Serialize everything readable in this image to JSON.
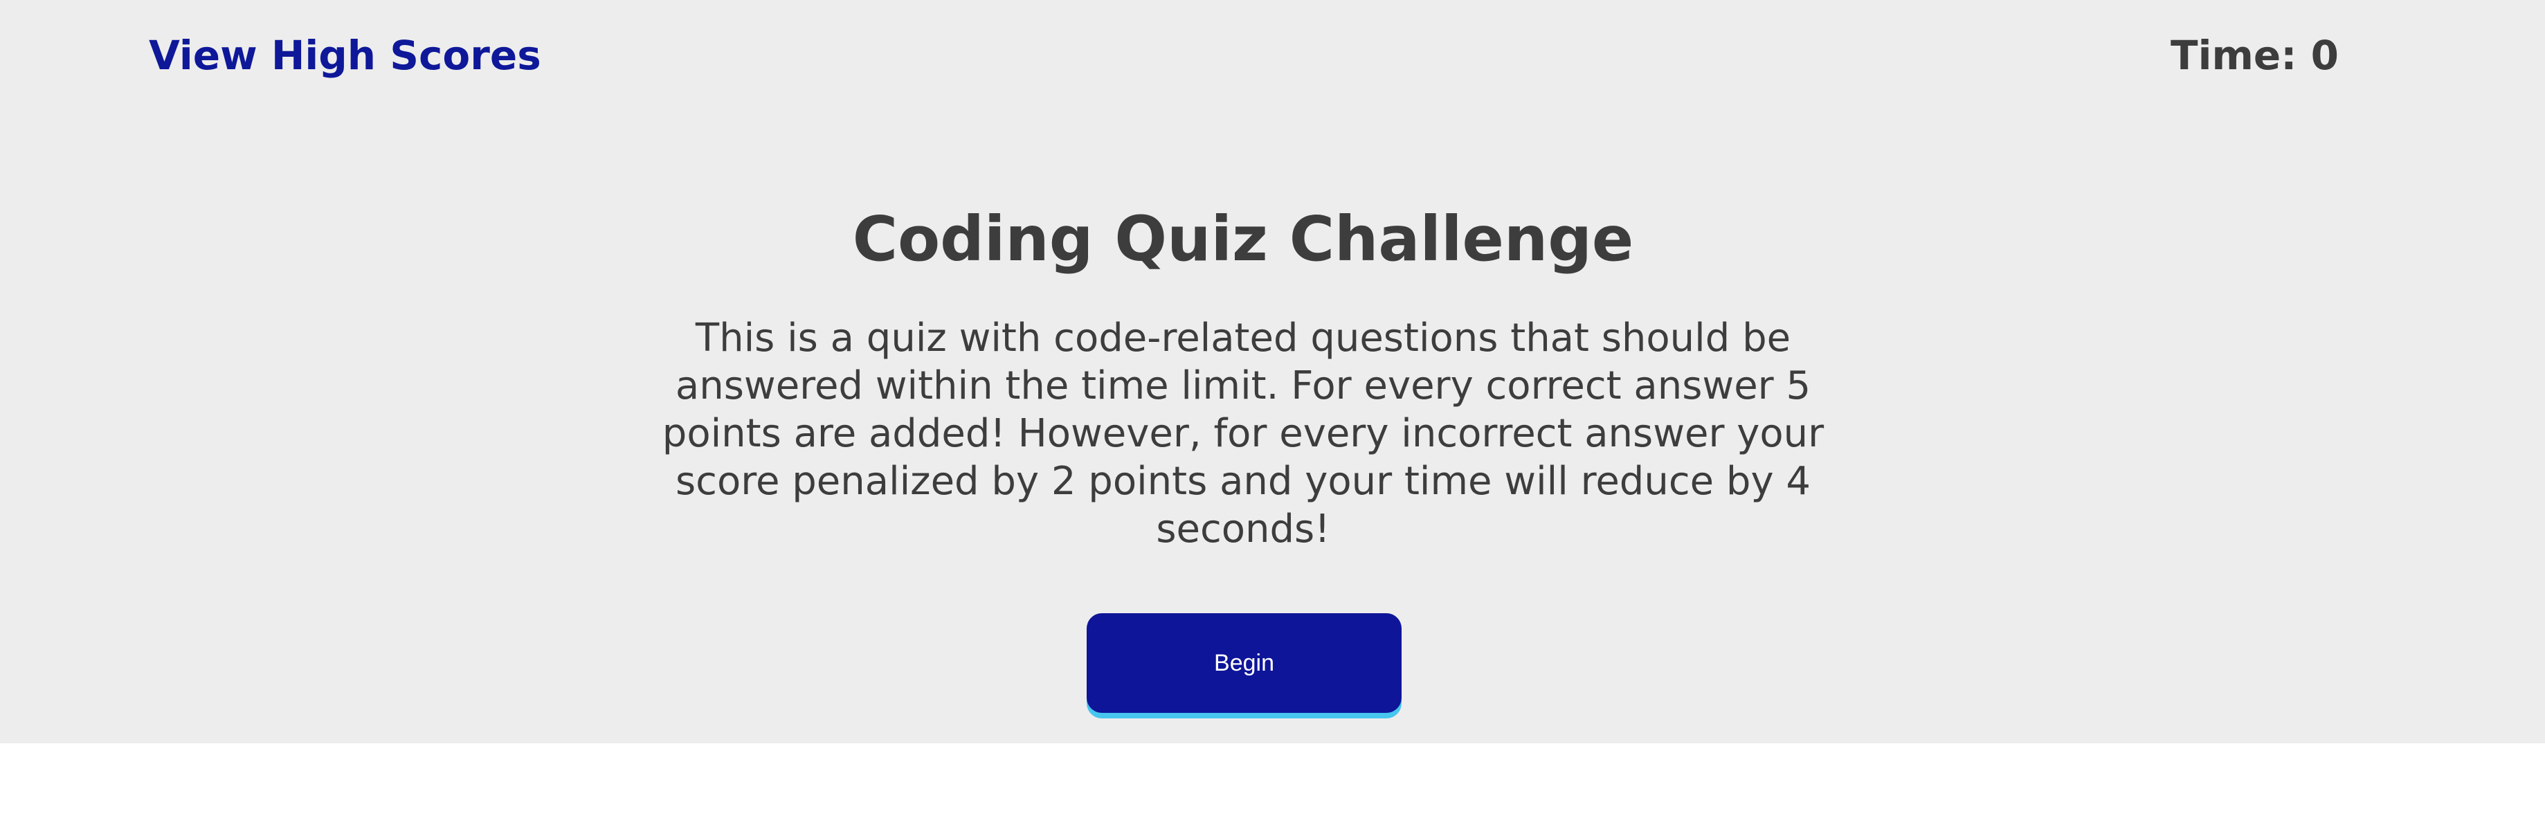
{
  "header": {
    "high_scores_link": "View High Scores",
    "timer_label": "Time:",
    "timer_value": "0"
  },
  "main": {
    "title": "Coding Quiz Challenge",
    "description": "This is a quiz with code-related questions that should be answered within the time limit. For every correct answer 5 points are added! However, for every incorrect answer your score penalized by 2 points and your time will reduce by 4 seconds!",
    "begin_button": "Begin"
  },
  "colors": {
    "panel_background": "#ededed",
    "page_background": "#ffffff",
    "link": "#0e1899",
    "text": "#3d3d3d",
    "button": "#0e1599",
    "button_underline": "#47c6ee",
    "button_text": "#ffffff"
  }
}
